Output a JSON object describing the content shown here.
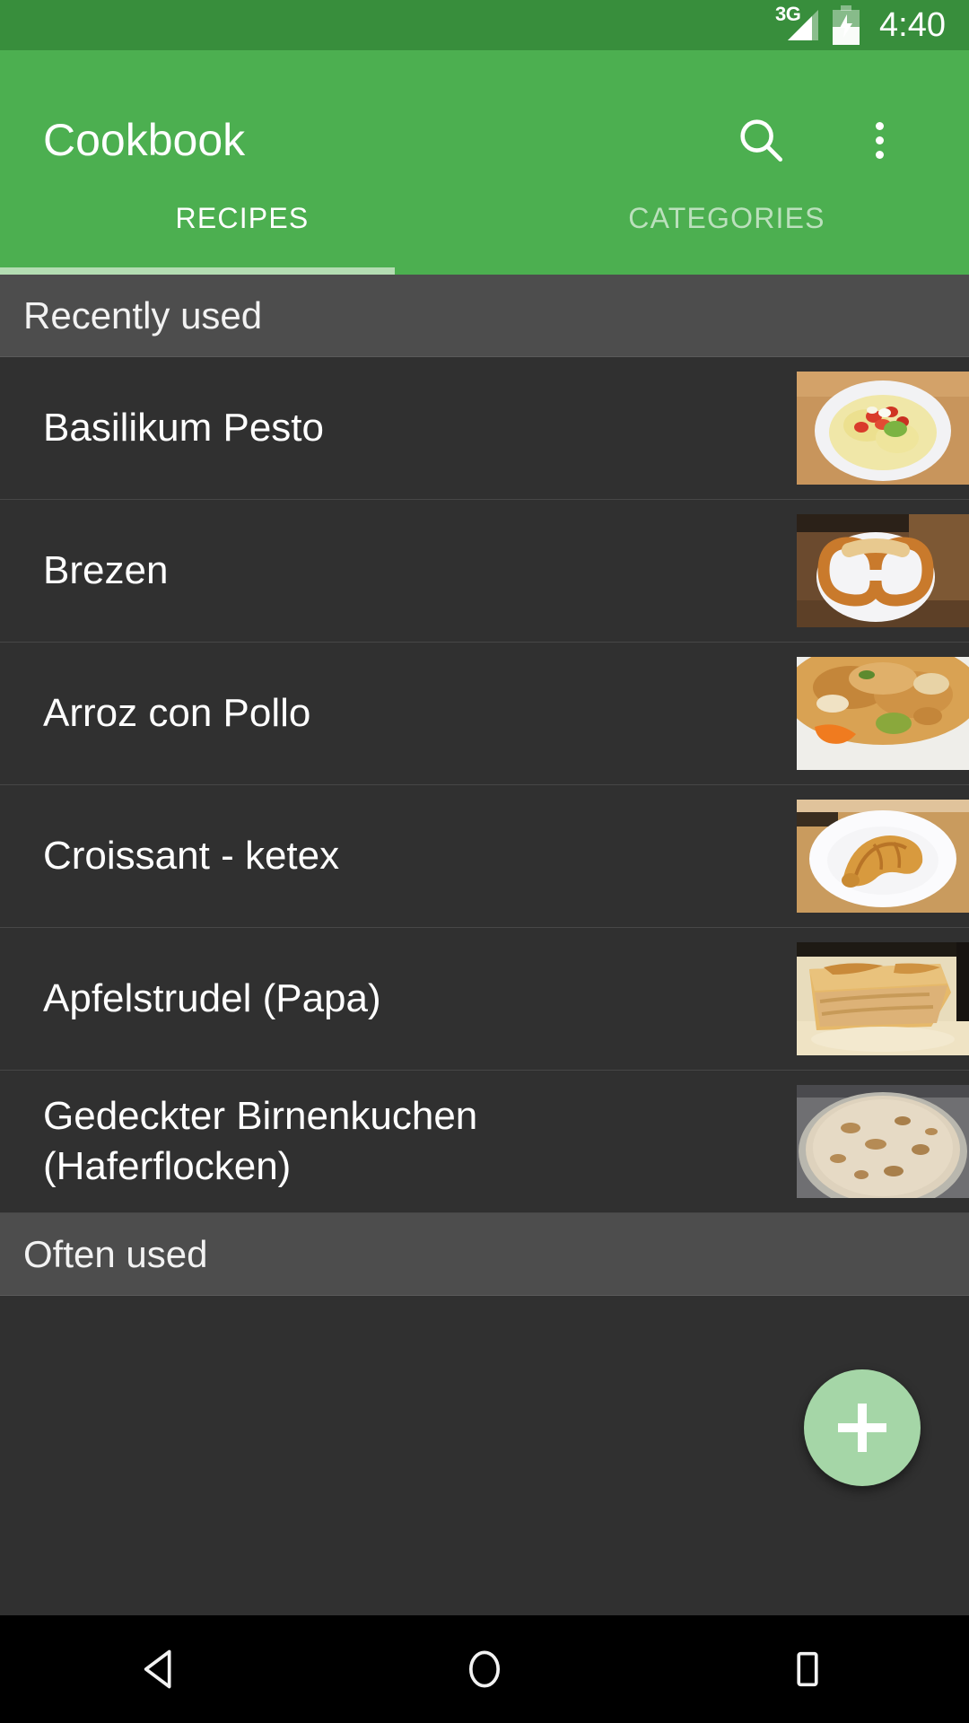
{
  "status_bar": {
    "network": "3G",
    "time": "4:40",
    "battery_state": "charging",
    "signal_icon": "signal-3g-icon",
    "battery_icon": "battery-charging-icon"
  },
  "app_bar": {
    "title": "Cookbook",
    "search_icon": "search-icon",
    "overflow_icon": "more-vertical-icon",
    "background_color": "#4caf50"
  },
  "tabs": {
    "items": [
      {
        "label": "RECIPES",
        "active": true
      },
      {
        "label": "CATEGORIES",
        "active": false
      }
    ],
    "indicator_color": "#b4ddb3"
  },
  "sections": [
    {
      "header": "Recently used",
      "recipes": [
        {
          "title": "Basilikum Pesto",
          "thumbnail": "pasta-with-tomato-pesto-photo"
        },
        {
          "title": "Brezen",
          "thumbnail": "pretzel-on-plate-photo"
        },
        {
          "title": "Arroz con Pollo",
          "thumbnail": "rice-with-chicken-photo"
        },
        {
          "title": "Croissant - ketex",
          "thumbnail": "croissant-on-plate-photo"
        },
        {
          "title": "Apfelstrudel (Papa)",
          "thumbnail": "apple-strudel-photo"
        },
        {
          "title": "Gedeckter Birnenkuchen (Haferflocken)",
          "thumbnail": "pear-cake-photo"
        }
      ]
    },
    {
      "header": "Often used",
      "recipes": []
    }
  ],
  "fab": {
    "icon": "plus-icon",
    "label": "+",
    "color": "#a5d6a7"
  },
  "nav_bar": {
    "back_icon": "back-triangle-icon",
    "home_icon": "home-circle-icon",
    "recents_icon": "recents-square-icon"
  }
}
